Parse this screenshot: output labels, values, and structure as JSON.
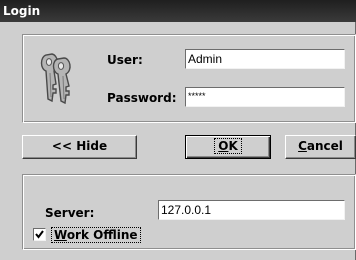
{
  "window": {
    "title": "Login"
  },
  "login": {
    "user_label": "User:",
    "user_value": "Admin",
    "password_label": "Password:",
    "password_value": "*****",
    "icon": "keys-icon"
  },
  "buttons": {
    "hide": "<< Hide",
    "ok_accel": "O",
    "ok_rest": "K",
    "cancel_accel": "C",
    "cancel_rest": "ancel"
  },
  "server": {
    "label": "Server:",
    "value": "127.0.0.1",
    "offline_accel": "W",
    "offline_rest": "ork Offline",
    "offline_checked": true
  },
  "colors": {
    "titlebar": "#2b2b2b",
    "face": "#cfcfcf"
  }
}
